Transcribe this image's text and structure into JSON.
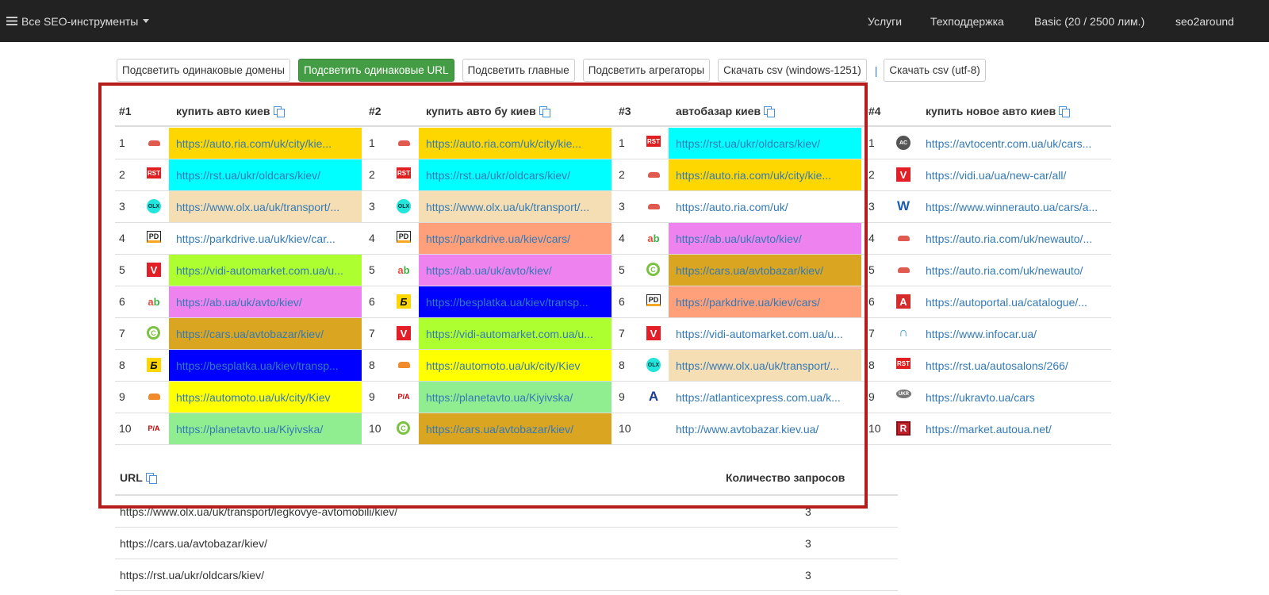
{
  "navbar": {
    "brand": "Все SEO-инструменты",
    "items": [
      "Услуги",
      "Техподдержка",
      "Basic (20 / 2500 лим.)",
      "seo2around"
    ]
  },
  "toolbar": {
    "buttons": [
      "Подсветить одинаковые домены",
      "Подсветить одинаковые URL",
      "Подсветить главные",
      "Подсветить агрегаторы",
      "Скачать csv (windows-1251)",
      "Скачать csv (utf-8)"
    ],
    "separator": "|"
  },
  "serp": {
    "columns": [
      {
        "num_label": "#1",
        "query": "купить авто киев",
        "rows": [
          {
            "pos": "1",
            "icon": "car",
            "url": "https://auto.ria.com/uk/city/kie...",
            "bg": "#ffd700"
          },
          {
            "pos": "2",
            "icon": "rst",
            "url": "https://rst.ua/ukr/oldcars/kiev/",
            "bg": "#00ffff"
          },
          {
            "pos": "3",
            "icon": "olx",
            "url": "https://www.olx.ua/uk/transport/...",
            "bg": "#f5deb3"
          },
          {
            "pos": "4",
            "icon": "pd",
            "url": "https://parkdrive.ua/uk/kiev/car...",
            "bg": ""
          },
          {
            "pos": "5",
            "icon": "vidi",
            "url": "https://vidi-automarket.com.ua/u...",
            "bg": "#adff2f"
          },
          {
            "pos": "6",
            "icon": "ab",
            "url": "https://ab.ua/uk/avto/kiev/",
            "bg": "#ee82ee"
          },
          {
            "pos": "7",
            "icon": "cars",
            "url": "https://cars.ua/avtobazar/kiev/",
            "bg": "#daa520"
          },
          {
            "pos": "8",
            "icon": "besp",
            "url": "https://besplatka.ua/kiev/transp...",
            "bg": "#0000ff"
          },
          {
            "pos": "9",
            "icon": "car-o",
            "url": "https://automoto.ua/uk/city/Kiev",
            "bg": "#ffff00"
          },
          {
            "pos": "10",
            "icon": "planet",
            "url": "https://planetavto.ua/Kiyivska/",
            "bg": "#90ee90"
          }
        ]
      },
      {
        "num_label": "#2",
        "query": "купить авто бу киев",
        "rows": [
          {
            "pos": "1",
            "icon": "car",
            "url": "https://auto.ria.com/uk/city/kie...",
            "bg": "#ffd700"
          },
          {
            "pos": "2",
            "icon": "rst",
            "url": "https://rst.ua/ukr/oldcars/kiev/",
            "bg": "#00ffff"
          },
          {
            "pos": "3",
            "icon": "olx",
            "url": "https://www.olx.ua/uk/transport/...",
            "bg": "#f5deb3"
          },
          {
            "pos": "4",
            "icon": "pd",
            "url": "https://parkdrive.ua/kiev/cars/",
            "bg": "#ffa07a"
          },
          {
            "pos": "5",
            "icon": "ab",
            "url": "https://ab.ua/uk/avto/kiev/",
            "bg": "#ee82ee"
          },
          {
            "pos": "6",
            "icon": "besp",
            "url": "https://besplatka.ua/kiev/transp...",
            "bg": "#0000ff"
          },
          {
            "pos": "7",
            "icon": "vidi",
            "url": "https://vidi-automarket.com.ua/u...",
            "bg": "#adff2f"
          },
          {
            "pos": "8",
            "icon": "car-o",
            "url": "https://automoto.ua/uk/city/Kiev",
            "bg": "#ffff00"
          },
          {
            "pos": "9",
            "icon": "planet",
            "url": "https://planetavto.ua/Kiyivska/",
            "bg": "#90ee90"
          },
          {
            "pos": "10",
            "icon": "cars",
            "url": "https://cars.ua/avtobazar/kiev/",
            "bg": "#daa520"
          }
        ]
      },
      {
        "num_label": "#3",
        "query": "автобазар киев",
        "rows": [
          {
            "pos": "1",
            "icon": "rst",
            "url": "https://rst.ua/ukr/oldcars/kiev/",
            "bg": "#00ffff"
          },
          {
            "pos": "2",
            "icon": "car",
            "url": "https://auto.ria.com/uk/city/kie...",
            "bg": "#ffd700"
          },
          {
            "pos": "3",
            "icon": "car",
            "url": "https://auto.ria.com/uk/",
            "bg": ""
          },
          {
            "pos": "4",
            "icon": "ab",
            "url": "https://ab.ua/uk/avto/kiev/",
            "bg": "#ee82ee"
          },
          {
            "pos": "5",
            "icon": "cars",
            "url": "https://cars.ua/avtobazar/kiev/",
            "bg": "#daa520"
          },
          {
            "pos": "6",
            "icon": "pd",
            "url": "https://parkdrive.ua/kiev/cars/",
            "bg": "#ffa07a"
          },
          {
            "pos": "7",
            "icon": "vidi",
            "url": "https://vidi-automarket.com.ua/u...",
            "bg": ""
          },
          {
            "pos": "8",
            "icon": "olx",
            "url": "https://www.olx.ua/uk/transport/...",
            "bg": "#f5deb3"
          },
          {
            "pos": "9",
            "icon": "atl",
            "url": "https://atlanticexpress.com.ua/k...",
            "bg": ""
          },
          {
            "pos": "10",
            "icon": "",
            "url": "http://www.avtobazar.kiev.ua/",
            "bg": ""
          }
        ]
      },
      {
        "num_label": "#4",
        "query": "купить новое авто киев",
        "rows": [
          {
            "pos": "1",
            "icon": "avc",
            "url": "https://avtocentr.com.ua/uk/cars...",
            "bg": ""
          },
          {
            "pos": "2",
            "icon": "vidi",
            "url": "https://vidi.ua/ua/new-car/all/",
            "bg": ""
          },
          {
            "pos": "3",
            "icon": "win",
            "url": "https://www.winnerauto.ua/cars/a...",
            "bg": ""
          },
          {
            "pos": "4",
            "icon": "car",
            "url": "https://auto.ria.com/uk/newauto/...",
            "bg": ""
          },
          {
            "pos": "5",
            "icon": "car",
            "url": "https://auto.ria.com/uk/newauto/",
            "bg": ""
          },
          {
            "pos": "6",
            "icon": "aport",
            "url": "https://autoportal.ua/catalogue/...",
            "bg": ""
          },
          {
            "pos": "7",
            "icon": "info",
            "url": "https://www.infocar.ua/",
            "bg": ""
          },
          {
            "pos": "8",
            "icon": "rst",
            "url": "https://rst.ua/autosalons/266/",
            "bg": ""
          },
          {
            "pos": "9",
            "icon": "ukr",
            "url": "https://ukravto.ua/cars",
            "bg": ""
          },
          {
            "pos": "10",
            "icon": "mkt",
            "url": "https://market.autoua.net/",
            "bg": ""
          }
        ]
      }
    ]
  },
  "url_table": {
    "header_url": "URL",
    "header_count": "Количество запросов",
    "rows": [
      {
        "url": "https://www.olx.ua/uk/transport/legkovye-avtomobili/kiev/",
        "count": "3"
      },
      {
        "url": "https://cars.ua/avtobazar/kiev/",
        "count": "3"
      },
      {
        "url": "https://rst.ua/ukr/oldcars/kiev/",
        "count": "3"
      }
    ]
  },
  "icon_glyphs": {
    "rst": "RST",
    "olx": "OLX",
    "pd": "PD",
    "vidi": "V",
    "ab": "ab",
    "cars": "C",
    "besp": "Б",
    "planet": "P/A",
    "atl": "A",
    "avc": "AC",
    "win": "W",
    "aport": "A",
    "info": "∩",
    "ukr": "UKR",
    "mkt": "R"
  }
}
